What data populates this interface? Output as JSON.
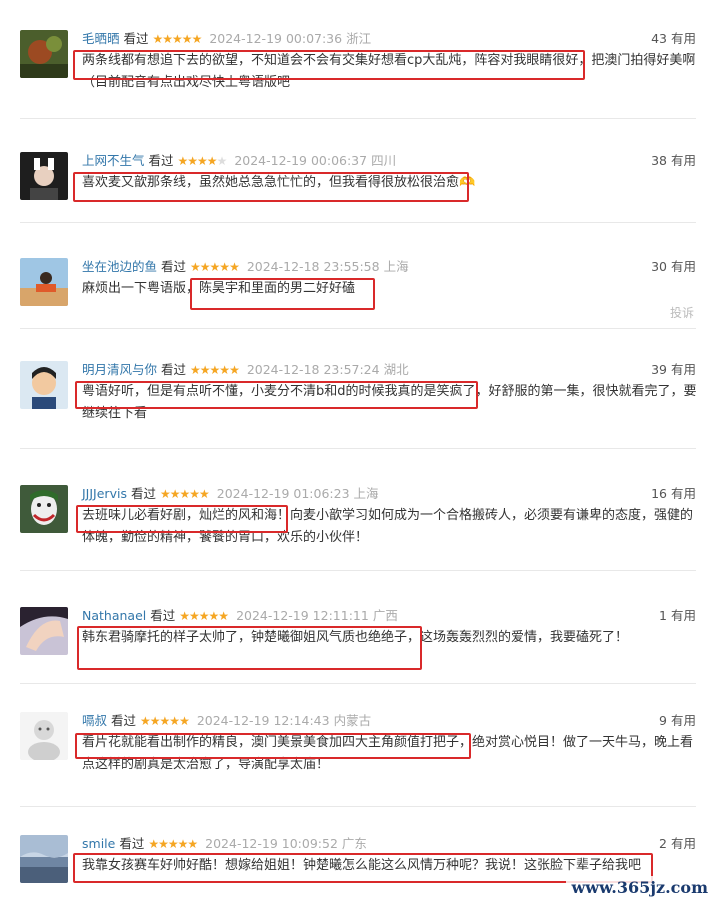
{
  "rate_label": "看过",
  "useful_unit": "有用",
  "report_label": "投诉",
  "watermark": "www.365jz.com",
  "reviews": [
    {
      "user": "毛晒晒",
      "stars": "★★★★★",
      "time": "2024-12-19 00:07:36",
      "loc": "浙江",
      "votes": "43",
      "text": "两条线都有想追下去的欲望，不知道会不会有交集好想看cp大乱炖，阵容对我眼睛很好，把澳门拍得好美啊（目前配音有点出戏尽快上粤语版吧"
    },
    {
      "user": "上网不生气",
      "stars": "★★★★",
      "stars_off": "★",
      "time": "2024-12-19 00:06:37",
      "loc": "四川",
      "votes": "38",
      "text": "喜欢麦又歆那条线，虽然她总急急忙忙的，但我看得很放松很治愈🫶"
    },
    {
      "user": "坐在池边的鱼",
      "stars": "★★★★★",
      "time": "2024-12-18 23:55:58",
      "loc": "上海",
      "votes": "30",
      "text": "麻烦出一下粤语版，陈昊宇和里面的男二好好磕"
    },
    {
      "user": "明月清风与你",
      "stars": "★★★★★",
      "time": "2024-12-18 23:57:24",
      "loc": "湖北",
      "votes": "39",
      "text": "粤语好听，但是有点听不懂，小麦分不清b和d的时候我真的是笑疯了，好舒服的第一集，很快就看完了，要继续往下看"
    },
    {
      "user": "JJJJervis",
      "stars": "★★★★★",
      "time": "2024-12-19 01:06:23",
      "loc": "上海",
      "votes": "16",
      "text": "去班味儿必看好剧，灿烂的风和海！向麦小歆学习如何成为一个合格搬砖人，必须要有谦卑的态度，强健的体魄，勤俭的精神，饕餮的胃口，欢乐的小伙伴！"
    },
    {
      "user": "Nathanael",
      "stars": "★★★★★",
      "time": "2024-12-19 12:11:11",
      "loc": "广西",
      "votes": "1",
      "text": "韩东君骑摩托的样子太帅了，钟楚曦御姐风气质也绝绝子，这场轰轰烈烈的爱情，我要磕死了！"
    },
    {
      "user": "嗝叔",
      "stars": "★★★★★",
      "time": "2024-12-19 12:14:43",
      "loc": "内蒙古",
      "votes": "9",
      "text": "看片花就能看出制作的精良，澳门美景美食加四大主角颜值打把子，绝对赏心悦目！做了一天牛马，晚上看点这样的剧真是太治愈了，导演配享太庙！"
    },
    {
      "user": "smile",
      "stars": "★★★★★",
      "time": "2024-12-19 10:09:52",
      "loc": "广东",
      "votes": "2",
      "text": "我靠女孩赛车好帅好酷！想嫁给姐姐！钟楚曦怎么能这么风情万种呢？我说！这张脸下辈子给我吧"
    }
  ]
}
